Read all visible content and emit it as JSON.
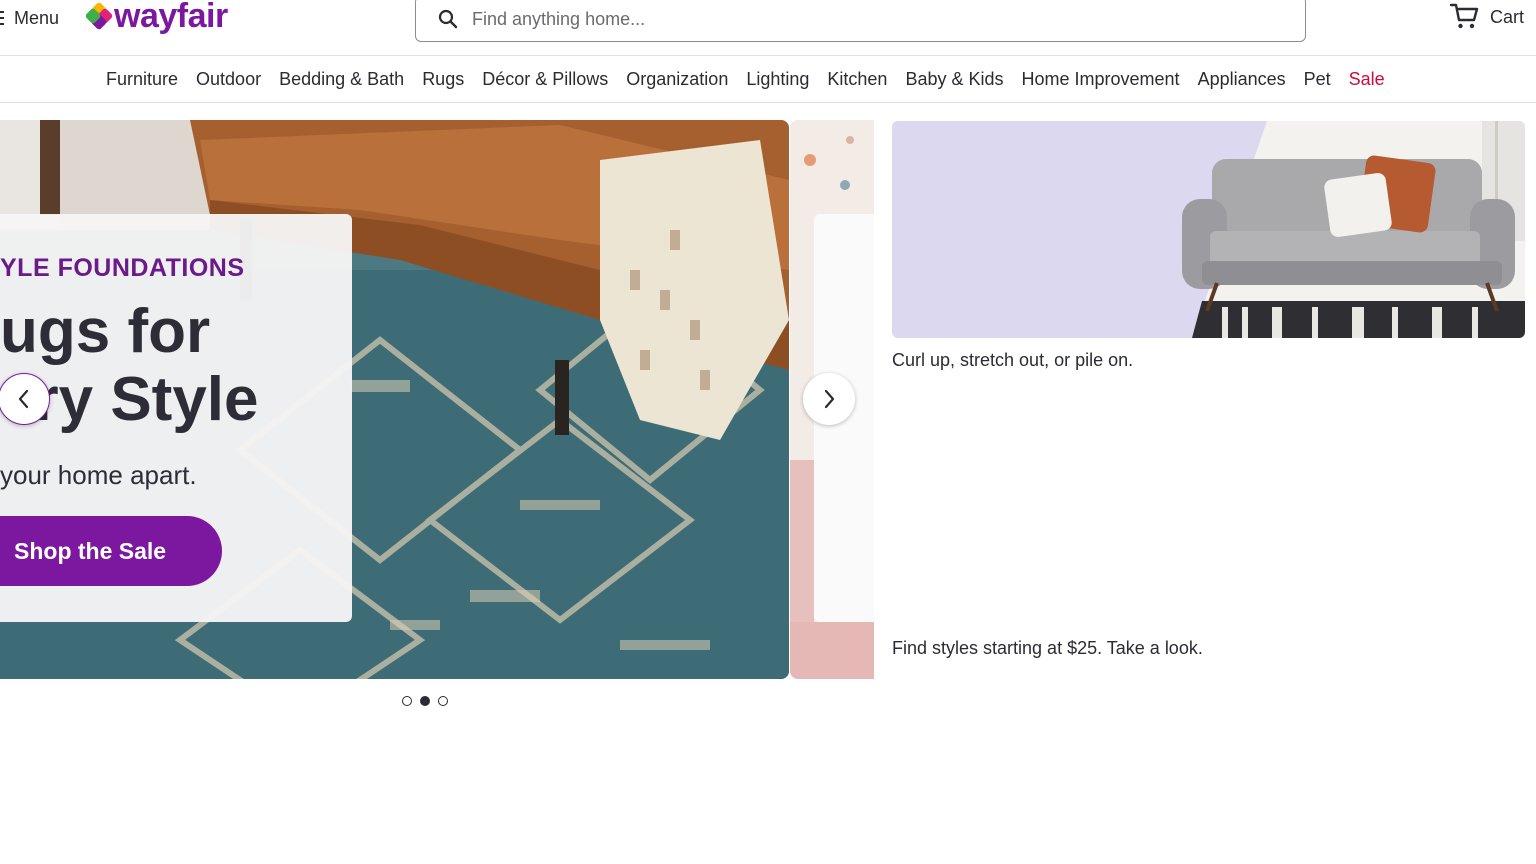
{
  "header": {
    "menu_label": "Menu",
    "logo_text": "wayfair",
    "search_placeholder": "Find anything home...",
    "cart_label": "Cart"
  },
  "nav": {
    "items": [
      {
        "label": "Furniture"
      },
      {
        "label": "Outdoor"
      },
      {
        "label": "Bedding & Bath"
      },
      {
        "label": "Rugs"
      },
      {
        "label": "Décor & Pillows"
      },
      {
        "label": "Organization"
      },
      {
        "label": "Lighting"
      },
      {
        "label": "Kitchen"
      },
      {
        "label": "Baby & Kids"
      },
      {
        "label": "Home Improvement"
      },
      {
        "label": "Appliances"
      },
      {
        "label": "Pet"
      },
      {
        "label": "Sale"
      }
    ]
  },
  "carousel": {
    "eyebrow": "YLE FOUNDATIONS",
    "title_line1": "ugs for",
    "title_line2": "ery Style",
    "subtitle": "your home apart.",
    "cta_label": "Shop the Sale",
    "slide_count": 3,
    "active_slide": 2
  },
  "promo": {
    "caption": "Curl up, stretch out, or pile on.",
    "caption2": "Find styles starting at $25. Take a look."
  },
  "colors": {
    "brand": "#7b189f",
    "sale": "#cc0d39",
    "text": "#2b2b33",
    "promo_bg": "#dcd8ef"
  },
  "icons": {
    "menu": "hamburger-icon",
    "search": "search-icon",
    "cart": "cart-icon",
    "prev": "chevron-left-icon",
    "next": "chevron-right-icon"
  }
}
